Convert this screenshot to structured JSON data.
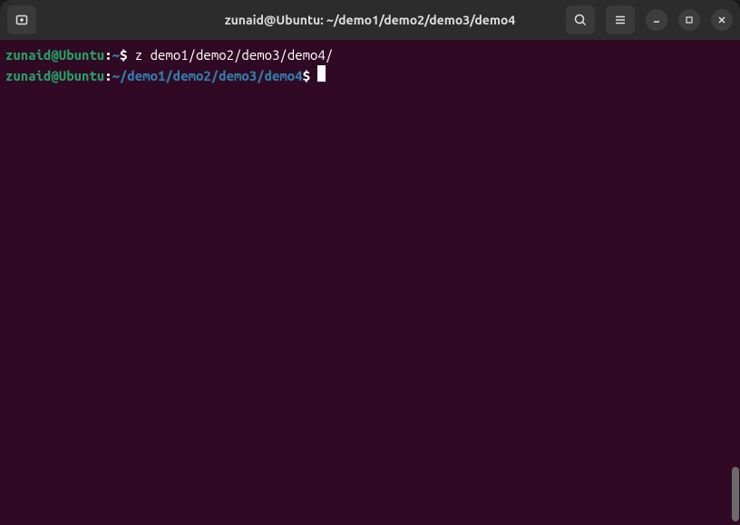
{
  "titlebar": {
    "title": "zunaid@Ubuntu: ~/demo1/demo2/demo3/demo4"
  },
  "terminal": {
    "lines": [
      {
        "userhost": "zunaid@Ubuntu",
        "colon": ":",
        "path": "~",
        "dollar": "$ ",
        "cmd": "z demo1/demo2/demo3/demo4/"
      },
      {
        "userhost": "zunaid@Ubuntu",
        "colon": ":",
        "path": "~/demo1/demo2/demo3/demo4",
        "dollar": "$ ",
        "cmd": ""
      }
    ]
  }
}
